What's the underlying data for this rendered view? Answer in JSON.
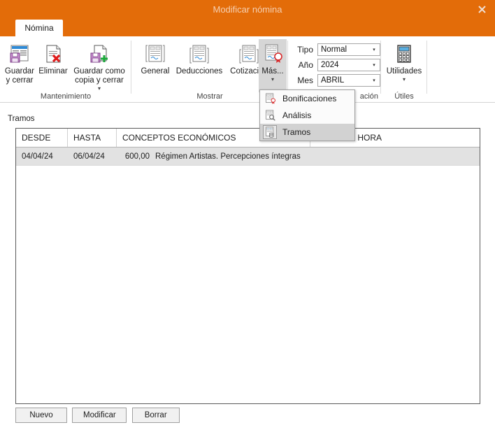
{
  "window": {
    "title": "Modificar nómina",
    "close_label": "✕",
    "accent_color": "#e36c09"
  },
  "ribbon": {
    "tabs": [
      {
        "label": "Nómina",
        "active": true
      }
    ],
    "groups": [
      {
        "label": "Mantenimiento"
      },
      {
        "label": "Mostrar"
      },
      {
        "label": "ación"
      },
      {
        "label": "Útiles"
      }
    ],
    "maintenance": {
      "save_close": "Guardar\ny cerrar",
      "delete": "Eliminar",
      "save_copy_close": "Guardar como\ncopia y cerrar",
      "save_copy_caret": "▾"
    },
    "show": {
      "general": "General",
      "deductions": "Deducciones",
      "quotation": "Cotización",
      "more": "Más...",
      "more_caret": "▾"
    },
    "liquidation": {
      "type_label": "Tipo",
      "type_value": "Normal",
      "year_label": "Año",
      "year_value": "2024",
      "month_label": "Mes",
      "month_value": "ABRIL",
      "arrow": "▾"
    },
    "tools": {
      "utilities": "Utilidades",
      "utilities_caret": "▾"
    }
  },
  "menu": {
    "items": [
      {
        "label": "Bonificaciones",
        "icon": "document-seal-icon",
        "active": false
      },
      {
        "label": "Análisis",
        "icon": "document-search-icon",
        "active": false
      },
      {
        "label": "Tramos",
        "icon": "document-sections-icon",
        "active": true
      }
    ]
  },
  "main": {
    "section_label": "Tramos",
    "grid": {
      "columns": [
        {
          "key": "desde",
          "label": "DESDE"
        },
        {
          "key": "hasta",
          "label": "HASTA"
        },
        {
          "key": "conceptos",
          "label": "CONCEPTOS ECONÓMICOS"
        },
        {
          "key": "tipos",
          "label": "TIPOS DE HORA"
        }
      ],
      "rows": [
        {
          "desde": "04/04/24",
          "hasta": "06/04/24",
          "importe": "600,00",
          "conceptos": "Régimen Artistas. Percepciones íntegras",
          "tipos": "",
          "selected": true
        }
      ]
    },
    "buttons": {
      "new": "Nuevo",
      "modify": "Modificar",
      "delete": "Borrar"
    }
  }
}
